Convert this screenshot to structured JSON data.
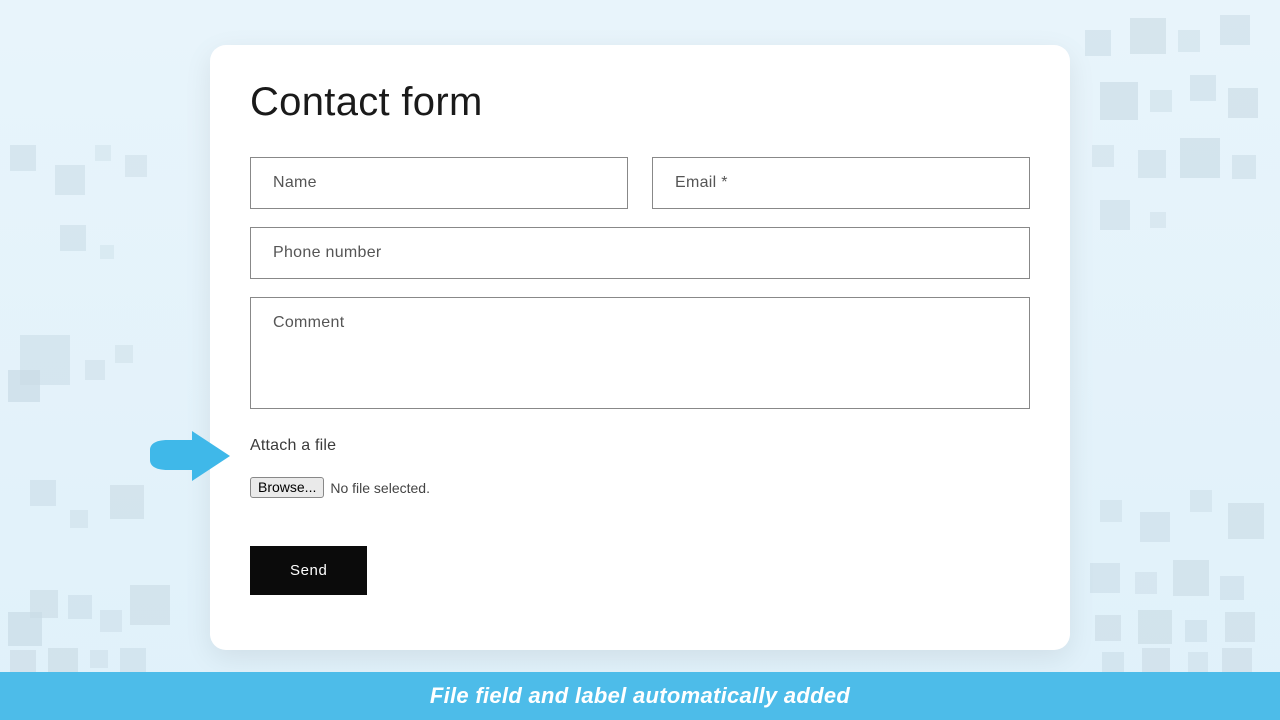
{
  "form": {
    "title": "Contact form",
    "name_placeholder": "Name",
    "email_placeholder": "Email *",
    "phone_placeholder": "Phone number",
    "comment_placeholder": "Comment",
    "attach_label": "Attach a file",
    "browse_label": "Browse...",
    "file_status": "No file selected.",
    "send_label": "Send"
  },
  "caption": "File field and label automatically added"
}
